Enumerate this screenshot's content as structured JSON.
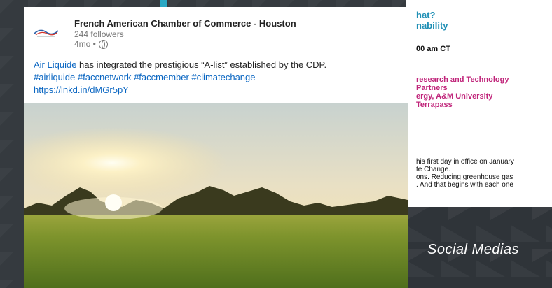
{
  "post": {
    "org_name": "French American Chamber of Commerce - Houston",
    "followers": "244 followers",
    "age": "4mo •",
    "text_link": "Air Liquide",
    "text_body": " has integrated the prestigious “A-list” established by the CDP.",
    "hashtags": "#airliquide #faccnetwork #faccmember #climatechange",
    "url": "https://lnkd.in/dMGr5pY",
    "image_alt": "sunset over green field"
  },
  "flyer": {
    "question_line1": "hat?",
    "question_line2": "nability",
    "time": "00 am CT",
    "speakers": [
      "research and Technology",
      "Partners",
      "ergy, A&M University",
      "Terrapass"
    ],
    "body": [
      "his first day in office on January",
      "te Change.",
      "ons. Reducing greenhouse gas",
      ". And that begins with each one"
    ]
  },
  "social": {
    "label": "Social Medias"
  },
  "colors": {
    "linkedin_blue": "#0a66c2",
    "teal": "#1f8fb5",
    "magenta": "#c0247a",
    "background": "#353a3f"
  },
  "icons": {
    "logo": "facc-logo",
    "visibility": "globe-icon"
  }
}
